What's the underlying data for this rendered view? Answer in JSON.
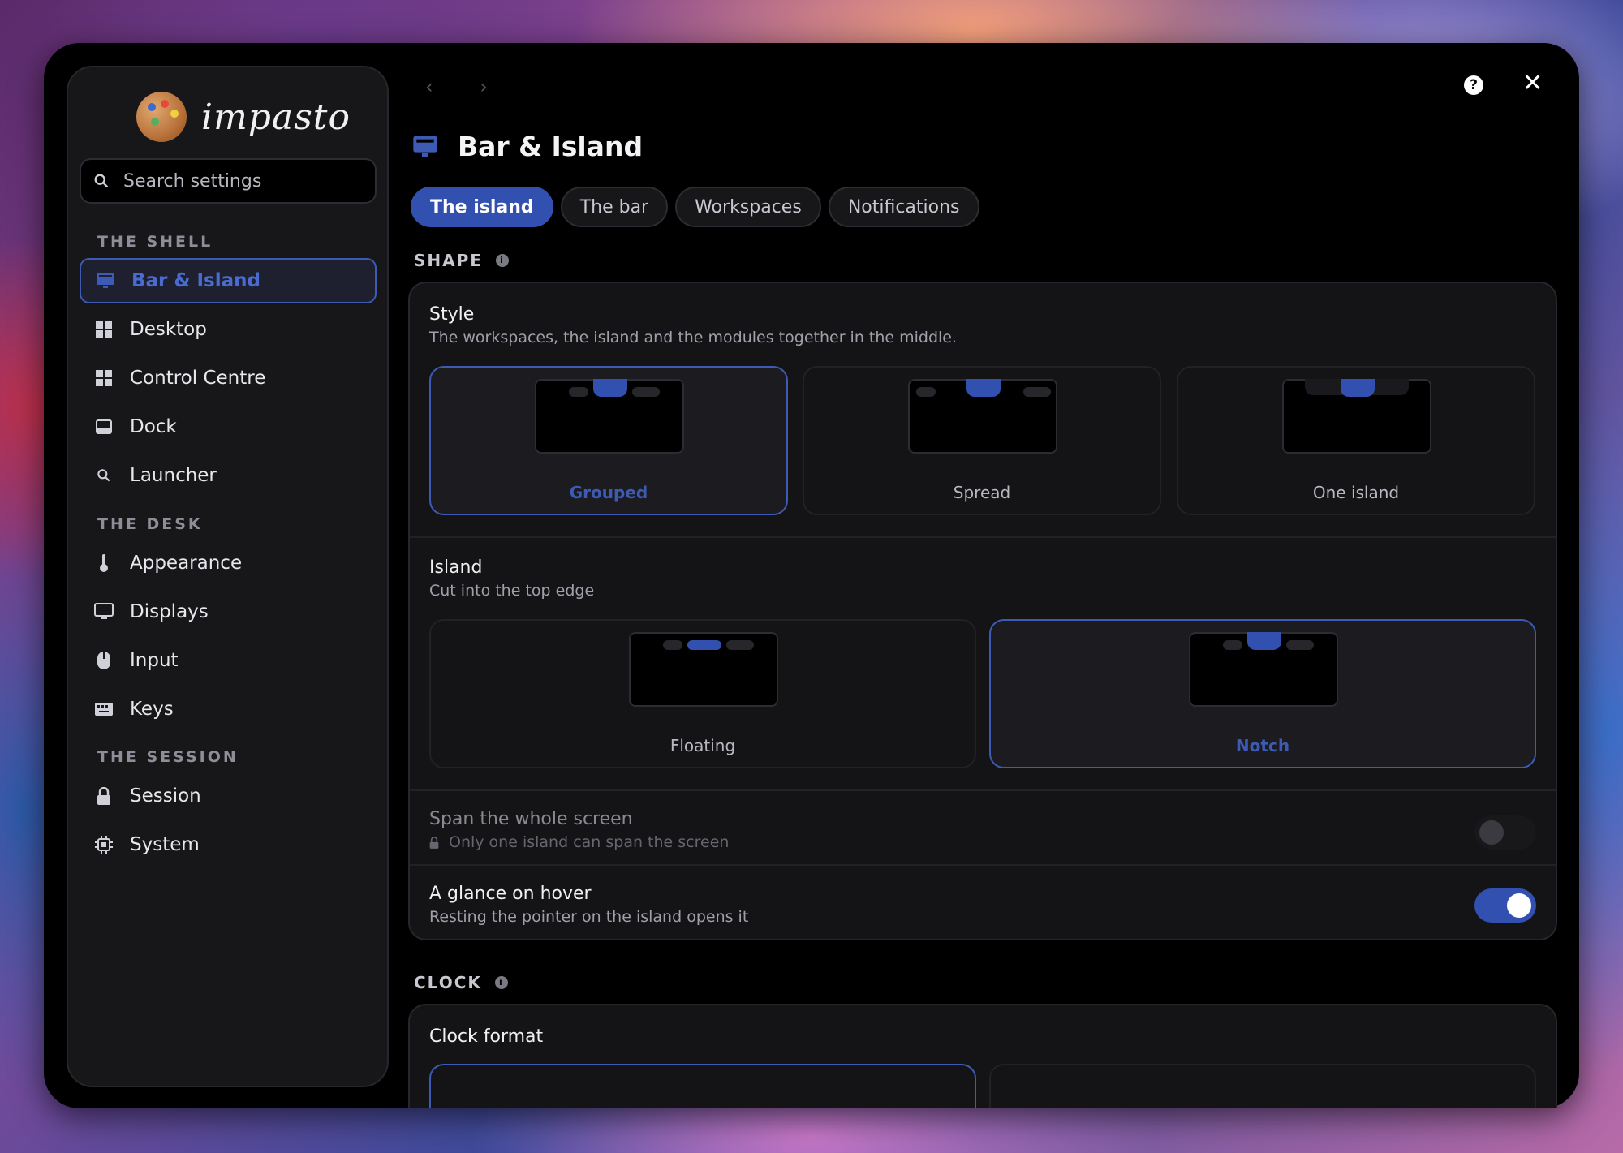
{
  "app": {
    "name": "impasto"
  },
  "search": {
    "placeholder": "Search settings"
  },
  "sidebar": {
    "sections": [
      {
        "title": "THE SHELL",
        "items": [
          {
            "label": "Bar & Island",
            "icon": "monitor-bar-icon",
            "active": true
          },
          {
            "label": "Desktop",
            "icon": "grid-icon"
          },
          {
            "label": "Control Centre",
            "icon": "grid-icon"
          },
          {
            "label": "Dock",
            "icon": "dock-icon"
          },
          {
            "label": "Launcher",
            "icon": "search-icon"
          }
        ]
      },
      {
        "title": "THE DESK",
        "items": [
          {
            "label": "Appearance",
            "icon": "thermometer-icon"
          },
          {
            "label": "Displays",
            "icon": "monitor-icon"
          },
          {
            "label": "Input",
            "icon": "mouse-icon"
          },
          {
            "label": "Keys",
            "icon": "keyboard-icon"
          }
        ]
      },
      {
        "title": "THE SESSION",
        "items": [
          {
            "label": "Session",
            "icon": "lock-icon"
          },
          {
            "label": "System",
            "icon": "chip-icon"
          }
        ]
      }
    ]
  },
  "header": {
    "title": "Bar & Island",
    "back": "‹",
    "forward": "›",
    "help": "?",
    "close": "✕"
  },
  "tabs": [
    {
      "label": "The island",
      "active": true
    },
    {
      "label": "The bar"
    },
    {
      "label": "Workspaces"
    },
    {
      "label": "Notifications"
    }
  ],
  "shape": {
    "heading": "SHAPE",
    "style": {
      "title": "Style",
      "subtitle": "The workspaces, the island and the modules together in the middle.",
      "options": [
        {
          "label": "Grouped",
          "selected": true
        },
        {
          "label": "Spread"
        },
        {
          "label": "One island"
        }
      ]
    },
    "island": {
      "title": "Island",
      "subtitle": "Cut into the top edge",
      "options": [
        {
          "label": "Floating"
        },
        {
          "label": "Notch",
          "selected": true
        }
      ]
    },
    "span": {
      "title": "Span the whole screen",
      "subtitle": "Only one island can span the screen",
      "enabled": false,
      "on": false
    },
    "glance": {
      "title": "A glance on hover",
      "subtitle": "Resting the pointer on the island opens it",
      "on": true
    }
  },
  "clock": {
    "heading": "CLOCK",
    "format_title": "Clock format"
  },
  "colors": {
    "accent": "#3250b0",
    "accent_text": "#3d5bb5",
    "bg": "#000000",
    "panel": "#17171a"
  }
}
